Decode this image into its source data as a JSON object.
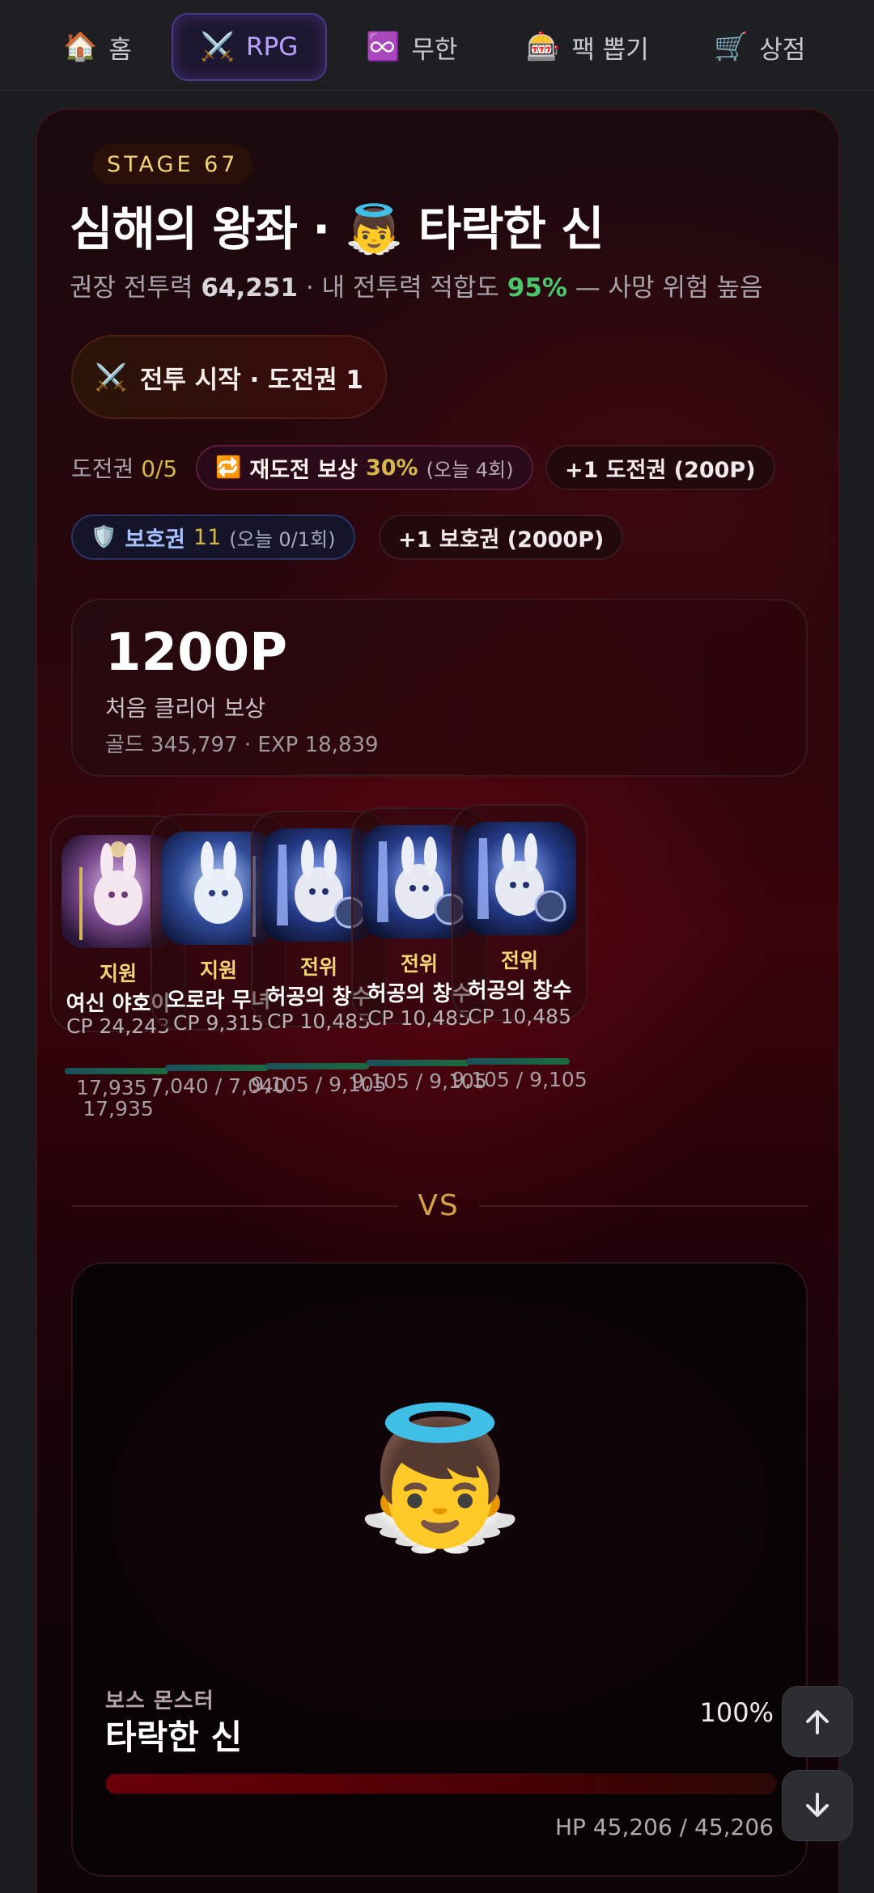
{
  "nav": {
    "items": [
      {
        "label": "홈",
        "icon": "🏠"
      },
      {
        "label": "RPG",
        "icon": "⚔️"
      },
      {
        "label": "무한",
        "icon": "♾️"
      },
      {
        "label": "팩 뽑기",
        "icon": "🎰"
      },
      {
        "label": "상점",
        "icon": "🛒"
      }
    ],
    "active": "RPG"
  },
  "stage": {
    "badge": "STAGE 67",
    "title": "심해의 왕좌 · 👼 타락한 신",
    "recommended_label": "권장 전투력",
    "recommended_value": "64,251",
    "sep": " · ",
    "fit_label": "내 전투력 적합도",
    "fit_value": "95%",
    "risk_text": " — 사망 위험 높음",
    "battle_icon": "⚔️",
    "battle_button": "전투 시작 · 도전권 1"
  },
  "tickets": {
    "label": "도전권",
    "value": "0/5",
    "retry_icon": "🔁",
    "retry_label": "재도전 보상",
    "retry_value": "30%",
    "retry_note": "(오늘 4회)",
    "buy_ticket": "+1 도전권 (200P)",
    "shield_icon": "🛡️",
    "shield_label": "보호권",
    "shield_value": "11",
    "shield_note": "(오늘 0/1회)",
    "buy_shield": "+1 보호권 (2000P)"
  },
  "reward": {
    "amount": "1200P",
    "label": "처음 클리어 보상",
    "detail": "골드 345,797 · EXP 18,839"
  },
  "heroes": [
    {
      "role": "지원",
      "name": "여신 야호이",
      "cp": "CP 24,243",
      "hp": "17,935 / 17,935",
      "hp_ratio": 1.0
    },
    {
      "role": "지원",
      "name": "오로라 무녀",
      "cp": "CP 9,315",
      "hp": "7,040 / 7,040",
      "hp_ratio": 1.0
    },
    {
      "role": "전위",
      "name": "허공의 창수",
      "cp": "CP 10,485",
      "hp": "9,105 / 9,105",
      "hp_ratio": 1.0
    },
    {
      "role": "전위",
      "name": "허공의 창수",
      "cp": "CP 10,485",
      "hp": "9,105 / 9,105",
      "hp_ratio": 1.0
    },
    {
      "role": "전위",
      "name": "허공의 창수",
      "cp": "CP 10,485",
      "hp": "9,105 / 9,105",
      "hp_ratio": 1.0
    }
  ],
  "versus": "VS",
  "boss": {
    "emoji": "👼",
    "kind": "보스 몬스터",
    "name": "타락한 신",
    "hp_percent": "100%",
    "hp": "HP 45,206 / 45,206",
    "hp_ratio": 1.0
  },
  "colors": {
    "accent_purple": "#b8a2ff",
    "gold": "#d6b74a",
    "fit_green": "#4cc66a",
    "boss_red": "#6a0008"
  }
}
